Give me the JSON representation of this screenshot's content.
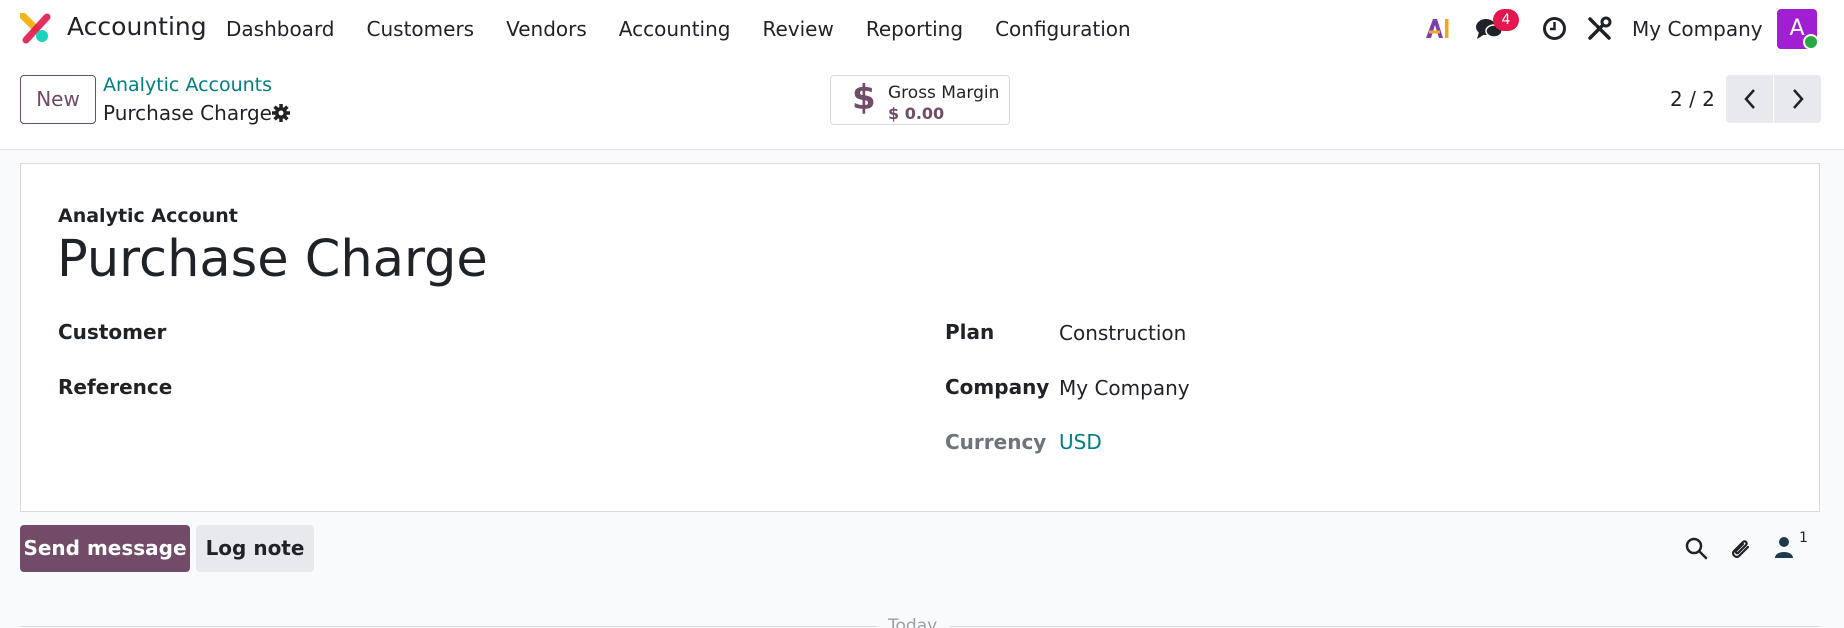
{
  "navbar": {
    "app_title": "Accounting",
    "menu": [
      "Dashboard",
      "Customers",
      "Vendors",
      "Accounting",
      "Review",
      "Reporting",
      "Configuration"
    ],
    "notification_count": "4",
    "company": "My Company",
    "avatar_initial": "A"
  },
  "control_panel": {
    "new_button": "New",
    "breadcrumb_parent": "Analytic Accounts",
    "record_name": "Purchase Charge",
    "stat_button": {
      "label": "Gross Margin",
      "value": "$ 0.00"
    },
    "pager": "2 / 2"
  },
  "form": {
    "top_label": "Analytic Account",
    "title": "Purchase Charge",
    "left_fields": [
      {
        "label": "Customer",
        "value": ""
      },
      {
        "label": "Reference",
        "value": ""
      }
    ],
    "right_fields": [
      {
        "label": "Plan",
        "value": "Construction"
      },
      {
        "label": "Company",
        "value": "My Company"
      },
      {
        "label": "Currency",
        "value": "USD"
      }
    ]
  },
  "chatter": {
    "send_message": "Send message",
    "log_note": "Log note",
    "follower_count": "1",
    "divider": "Today"
  },
  "colors": {
    "brand": "#714b67",
    "link": "#017e84",
    "badge": "#e2184e",
    "avatar": "#a11fd2"
  }
}
